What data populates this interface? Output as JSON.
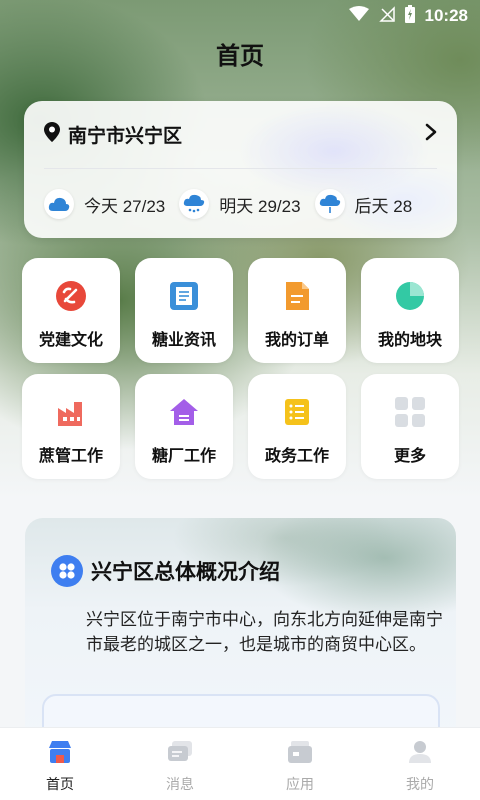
{
  "status_bar": {
    "time": "10:28"
  },
  "header": {
    "title": "首页"
  },
  "location": {
    "name": "南宁市兴宁区"
  },
  "weather": [
    {
      "label": "今天 27/23",
      "icon": "cloud-icon"
    },
    {
      "label": "明天 29/23",
      "icon": "rain-cloud-icon"
    },
    {
      "label": "后天 28",
      "icon": "cloud-rain-icon"
    }
  ],
  "grid": [
    {
      "label": "党建文化",
      "icon": "party-emblem-icon",
      "color": "#e8483a"
    },
    {
      "label": "糖业资讯",
      "icon": "news-document-icon",
      "color": "#3a8fd9"
    },
    {
      "label": "我的订单",
      "icon": "order-document-icon",
      "color": "#f29a2e"
    },
    {
      "label": "我的地块",
      "icon": "pie-chart-icon",
      "color": "#33c9a4"
    },
    {
      "label": "蔗管工作",
      "icon": "factory-icon",
      "color": "#ef6a5e"
    },
    {
      "label": "糖厂工作",
      "icon": "house-icon",
      "color": "#a35ee8"
    },
    {
      "label": "政务工作",
      "icon": "list-document-icon",
      "color": "#f5c21b"
    },
    {
      "label": "更多",
      "icon": "grid-more-icon",
      "color": "#d9dde2"
    }
  ],
  "intro": {
    "title": "兴宁区总体概况介绍",
    "body": "兴宁区位于南宁市中心，向东北方向延伸是南宁市最老的城区之一，也是城市的商贸中心区。"
  },
  "tabbar": [
    {
      "label": "首页",
      "icon": "home-store-icon",
      "active": true
    },
    {
      "label": "消息",
      "icon": "message-icon",
      "active": false
    },
    {
      "label": "应用",
      "icon": "apps-icon",
      "active": false
    },
    {
      "label": "我的",
      "icon": "profile-icon",
      "active": false
    }
  ]
}
